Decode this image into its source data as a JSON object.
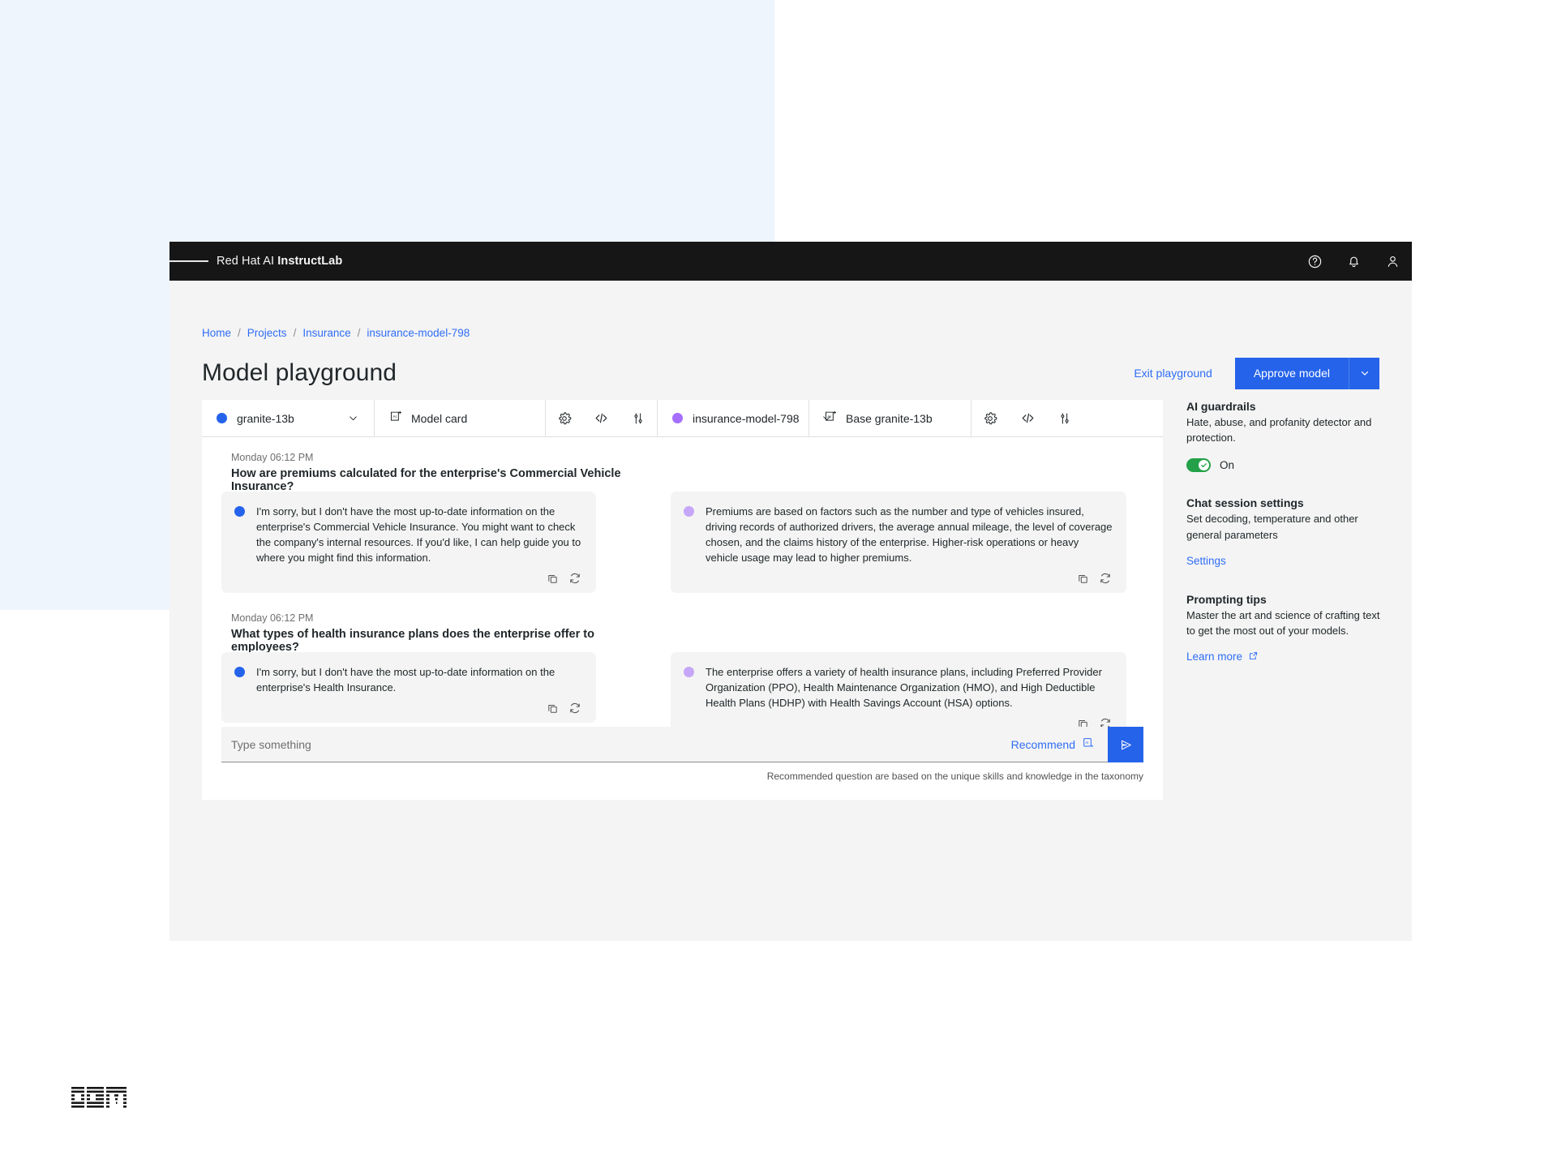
{
  "appbar": {
    "menu_icon": "hamburger-menu-icon",
    "brand_prefix": "Red Hat AI ",
    "brand_bold": "InstructLab",
    "icons": [
      "help-icon",
      "notification-bell-icon",
      "user-avatar-icon"
    ]
  },
  "breadcrumb": {
    "items": [
      "Home",
      "Projects",
      "Insurance",
      "insurance-model-798"
    ],
    "separator": "/"
  },
  "header": {
    "title": "Model playground",
    "exit_label": "Exit playground",
    "approve_label": "Approve model",
    "approve_chevron": "chevron-down-icon"
  },
  "toolbar": {
    "left": {
      "model_name": "granite-13b",
      "model_dot_color": "#2563eb",
      "model_card_label": "Model card",
      "model_card_icon": "ai-model-card-icon",
      "chevron": "chevron-down-icon",
      "icons": [
        "gear-icon",
        "code-icon",
        "sliders-icon"
      ]
    },
    "right": {
      "model_name": "insurance-model-798",
      "model_dot_color": "#a56eff",
      "model_card_label": "Base  granite-13b",
      "model_card_icon": "ai-model-card-icon",
      "chevron": "chevron-down-icon",
      "icons": [
        "gear-icon",
        "code-icon",
        "sliders-icon"
      ]
    }
  },
  "chat": {
    "turns": [
      {
        "time": "Monday 06:12 PM",
        "question": "How are premiums calculated for the enterprise's Commercial Vehicle Insurance?",
        "left_answer": "I'm sorry, but I don't have the most up-to-date information on the enterprise's Commercial Vehicle Insurance. You might want to check the company's internal resources. If you'd like, I can help guide you to where you might find this information.",
        "right_answer": "Premiums are based on factors such as the number and type of vehicles insured, driving records of authorized drivers, the average annual mileage, the level of coverage chosen, and the claims history of the enterprise. Higher-risk operations or heavy vehicle usage may lead to higher premiums."
      },
      {
        "time": "Monday 06:12 PM",
        "question": "What types of health insurance plans does the enterprise offer to employees?",
        "left_answer": "I'm sorry, but I don't have the most up-to-date information on the enterprise's Health Insurance.",
        "right_answer": "The enterprise offers a variety of health insurance plans, including Preferred Provider Organization (PPO), Health Maintenance Organization (HMO), and High Deductible Health Plans (HDHP) with Health Savings Account (HSA) options."
      }
    ],
    "bubble_actions": [
      "copy-icon",
      "regenerate-icon"
    ]
  },
  "composer": {
    "placeholder": "Type something",
    "value": "",
    "recommend_label": "Recommend",
    "recommend_icon": "ai-recommend-icon",
    "send_icon": "send-icon",
    "hint": "Recommended question are based on the unique skills and knowledge in the taxonomy"
  },
  "right_panel": {
    "guardrails": {
      "title": "AI guardrails",
      "description": "Hate, abuse, and profanity detector and protection.",
      "toggle_state": "On",
      "toggle_color": "#24a148"
    },
    "chat_settings": {
      "title": "Chat session settings",
      "description": "Set decoding, temperature and other general parameters",
      "link": "Settings"
    },
    "prompting_tips": {
      "title": "Prompting tips",
      "description": "Master the art and science of crafting text to get the most out of your models.",
      "link": "Learn more",
      "link_icon": "external-link-icon"
    }
  },
  "footer": {
    "logo": "IBM"
  },
  "colors": {
    "accent_blue": "#2563eb",
    "link_blue": "#2f6df6",
    "appbar_black": "#161616",
    "surface_gray": "#f4f4f4",
    "purple_dot": "#a56eff",
    "green_toggle": "#24a148"
  }
}
